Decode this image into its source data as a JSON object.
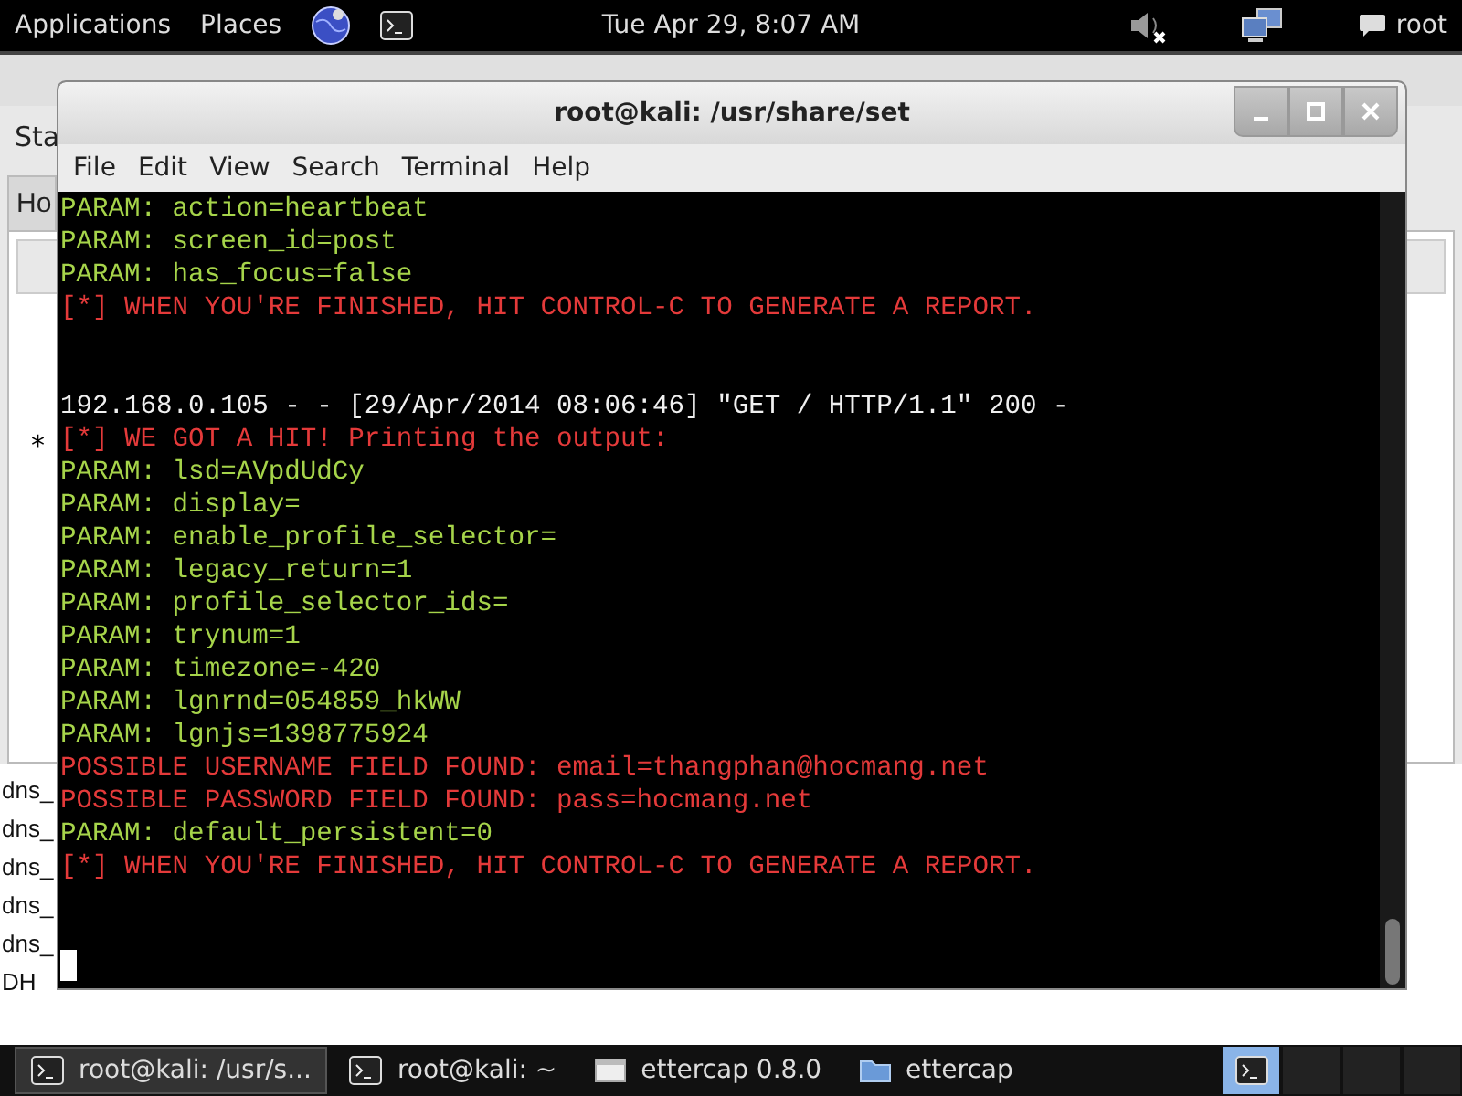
{
  "top_panel": {
    "menus": [
      "Applications",
      "Places"
    ],
    "clock": "Tue Apr 29,  8:07 AM",
    "user": "root"
  },
  "background_window": {
    "menu_label": "Sta",
    "tab_label": "Ho",
    "marker": "*",
    "list": [
      "dns_",
      "dns_",
      "dns_",
      "dns_",
      "dns_",
      "DH"
    ]
  },
  "terminal": {
    "title": "root@kali: /usr/share/set",
    "menu": [
      "File",
      "Edit",
      "View",
      "Search",
      "Terminal",
      "Help"
    ],
    "lines": [
      {
        "kind": "param",
        "text": "PARAM: action=heartbeat"
      },
      {
        "kind": "param",
        "text": "PARAM: screen_id=post"
      },
      {
        "kind": "param",
        "text": "PARAM: has_focus=false"
      },
      {
        "kind": "alert",
        "text": "[*] WHEN YOU'RE FINISHED, HIT CONTROL-C TO GENERATE A REPORT."
      },
      {
        "kind": "blank"
      },
      {
        "kind": "blank"
      },
      {
        "kind": "log",
        "text": "192.168.0.105 - - [29/Apr/2014 08:06:46] \"GET / HTTP/1.1\" 200 -"
      },
      {
        "kind": "alert",
        "text": "[*] WE GOT A HIT! Printing the output:"
      },
      {
        "kind": "param",
        "text": "PARAM: lsd=AVpdUdCy"
      },
      {
        "kind": "param",
        "text": "PARAM: display="
      },
      {
        "kind": "param",
        "text": "PARAM: enable_profile_selector="
      },
      {
        "kind": "param",
        "text": "PARAM: legacy_return=1"
      },
      {
        "kind": "param",
        "text": "PARAM: profile_selector_ids="
      },
      {
        "kind": "param",
        "text": "PARAM: trynum=1"
      },
      {
        "kind": "param",
        "text": "PARAM: timezone=-420"
      },
      {
        "kind": "param",
        "text": "PARAM: lgnrnd=054859_hkWW"
      },
      {
        "kind": "param",
        "text": "PARAM: lgnjs=1398775924"
      },
      {
        "kind": "alert",
        "text": "POSSIBLE USERNAME FIELD FOUND: email=thangphan@hocmang.net"
      },
      {
        "kind": "alert",
        "text": "POSSIBLE PASSWORD FIELD FOUND: pass=hocmang.net"
      },
      {
        "kind": "param",
        "text": "PARAM: default_persistent=0"
      },
      {
        "kind": "alert",
        "text": "[*] WHEN YOU'RE FINISHED, HIT CONTROL-C TO GENERATE A REPORT."
      },
      {
        "kind": "blank"
      },
      {
        "kind": "blank"
      },
      {
        "kind": "cursor"
      }
    ]
  },
  "taskbar": {
    "items": [
      {
        "kind": "terminal",
        "label": "root@kali: /usr/s...",
        "selected": true
      },
      {
        "kind": "terminal",
        "label": "root@kali: ~",
        "selected": false
      },
      {
        "kind": "window",
        "label": "ettercap 0.8.0",
        "selected": false
      },
      {
        "kind": "folder",
        "label": "ettercap",
        "selected": false
      }
    ],
    "workspaces": [
      {
        "selected": true
      },
      {
        "selected": false
      },
      {
        "selected": false
      },
      {
        "selected": false
      }
    ]
  }
}
